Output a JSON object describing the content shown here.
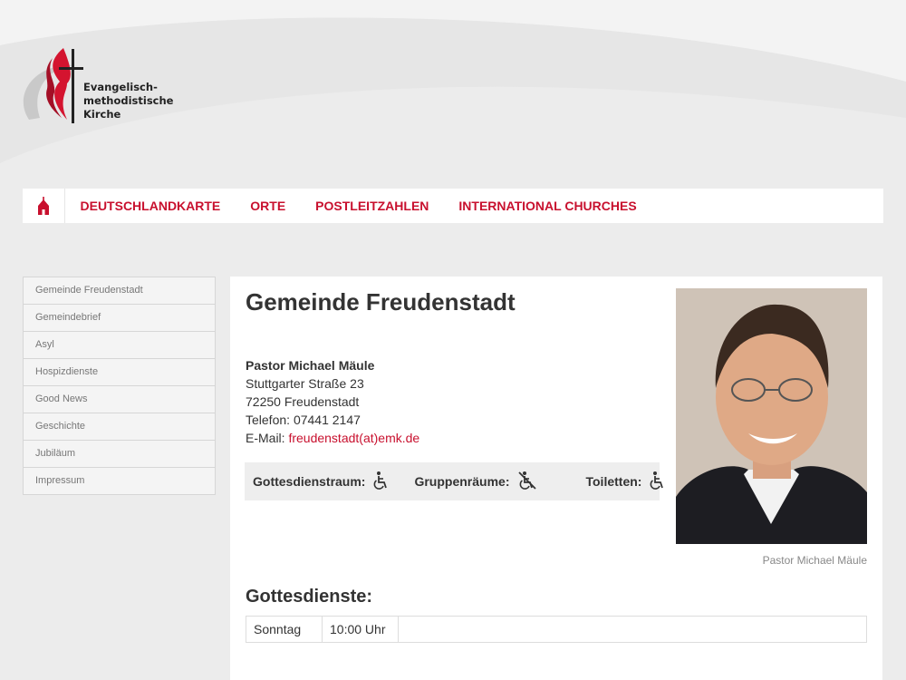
{
  "brand": {
    "lines": [
      "Evangelisch-",
      "methodistische",
      "Kirche"
    ],
    "colors": {
      "accent": "#c8102e",
      "text": "#333333",
      "background": "#ececec"
    }
  },
  "nav": {
    "home_icon": "church-icon",
    "items": [
      {
        "label": "DEUTSCHLANDKARTE"
      },
      {
        "label": "ORTE"
      },
      {
        "label": "POSTLEITZAHLEN"
      },
      {
        "label": "INTERNATIONAL CHURCHES"
      }
    ]
  },
  "sidebar": {
    "items": [
      {
        "label": "Gemeinde Freudenstadt"
      },
      {
        "label": "Gemeindebrief"
      },
      {
        "label": "Asyl"
      },
      {
        "label": "Hospizdienste"
      },
      {
        "label": "Good News"
      },
      {
        "label": "Geschichte"
      },
      {
        "label": "Jubiläum"
      },
      {
        "label": "Impressum"
      }
    ]
  },
  "main": {
    "title": "Gemeinde Freudenstadt",
    "contact": {
      "name": "Pastor Michael Mäule",
      "street": "Stuttgarter Straße 23",
      "city": "72250 Freudenstadt",
      "phone_label": "Telefon:",
      "phone": "07441 2147",
      "email_label": "E-Mail:",
      "email": "freudenstadt(at)emk.de"
    },
    "accessibility": [
      {
        "label": "Gottesdienstraum:",
        "icon": "wheelchair-icon"
      },
      {
        "label": "Gruppenräume:",
        "icon": "no-wheelchair-icon"
      },
      {
        "label": "Toiletten:",
        "icon": "wheelchair-icon"
      }
    ],
    "photo_caption": "Pastor Michael Mäule",
    "services_heading": "Gottesdienste:",
    "services": [
      {
        "day": "Sonntag",
        "time": "10:00 Uhr",
        "note": ""
      }
    ]
  }
}
